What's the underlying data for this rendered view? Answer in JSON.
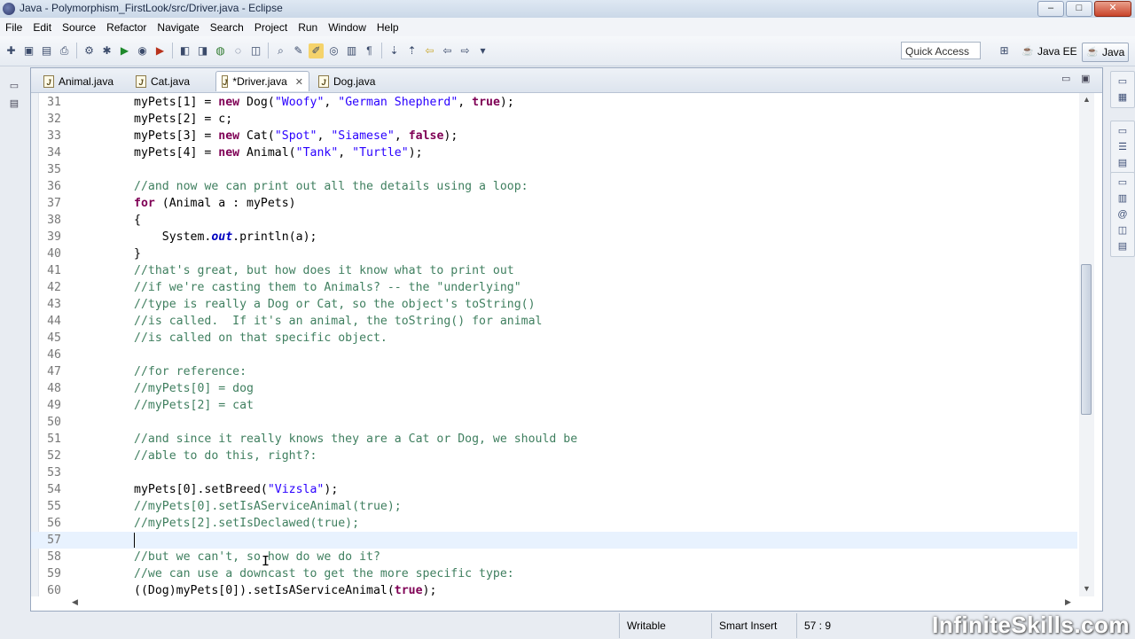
{
  "window": {
    "title": "Java - Polymorphism_FirstLook/src/Driver.java - Eclipse",
    "minimize": "–",
    "maximize": "□",
    "close": "✕"
  },
  "menu": [
    "File",
    "Edit",
    "Source",
    "Refactor",
    "Navigate",
    "Search",
    "Project",
    "Run",
    "Window",
    "Help"
  ],
  "toolbar": {
    "quick_access": "Quick Access",
    "perspectives": [
      {
        "label": "Java EE",
        "active": false
      },
      {
        "label": "Java",
        "active": true
      }
    ]
  },
  "tabs": [
    {
      "label": "Animal.java",
      "active": false
    },
    {
      "label": "Cat.java",
      "active": false
    },
    {
      "label": "*Driver.java",
      "active": true
    },
    {
      "label": "Dog.java",
      "active": false
    }
  ],
  "code_lines": [
    {
      "n": "31",
      "t": "myPets[1] = new Dog(\"Woofy\", \"German Shepherd\", true);"
    },
    {
      "n": "32",
      "t": "myPets[2] = c;"
    },
    {
      "n": "33",
      "t": "myPets[3] = new Cat(\"Spot\", \"Siamese\", false);"
    },
    {
      "n": "34",
      "t": "myPets[4] = new Animal(\"Tank\", \"Turtle\");"
    },
    {
      "n": "35",
      "t": ""
    },
    {
      "n": "36",
      "t": "//and now we can print out all the details using a loop:"
    },
    {
      "n": "37",
      "t": "for (Animal a : myPets)"
    },
    {
      "n": "38",
      "t": "{"
    },
    {
      "n": "39",
      "t": "    System.out.println(a);"
    },
    {
      "n": "40",
      "t": "}"
    },
    {
      "n": "41",
      "t": "//that's great, but how does it know what to print out"
    },
    {
      "n": "42",
      "t": "//if we're casting them to Animals? -- the \"underlying\""
    },
    {
      "n": "43",
      "t": "//type is really a Dog or Cat, so the object's toString()"
    },
    {
      "n": "44",
      "t": "//is called.  If it's an animal, the toString() for animal"
    },
    {
      "n": "45",
      "t": "//is called on that specific object."
    },
    {
      "n": "46",
      "t": ""
    },
    {
      "n": "47",
      "t": "//for reference:"
    },
    {
      "n": "48",
      "t": "//myPets[0] = dog"
    },
    {
      "n": "49",
      "t": "//myPets[2] = cat"
    },
    {
      "n": "50",
      "t": ""
    },
    {
      "n": "51",
      "t": "//and since it really knows they are a Cat or Dog, we should be"
    },
    {
      "n": "52",
      "t": "//able to do this, right?:"
    },
    {
      "n": "53",
      "t": ""
    },
    {
      "n": "54",
      "t": "myPets[0].setBreed(\"Vizsla\");"
    },
    {
      "n": "55",
      "t": "//myPets[0].setIsAServiceAnimal(true);"
    },
    {
      "n": "56",
      "t": "//myPets[2].setIsDeclawed(true);"
    },
    {
      "n": "57",
      "t": ""
    },
    {
      "n": "58",
      "t": "//but we can't, so how do we do it?"
    },
    {
      "n": "59",
      "t": "//we can use a downcast to get the more specific type:"
    },
    {
      "n": "60",
      "t": "((Dog)myPets[0]).setIsAServiceAnimal(true);"
    }
  ],
  "current_line": "57",
  "status": {
    "writable": "Writable",
    "insert_mode": "Smart Insert",
    "position": "57 : 9"
  },
  "watermark": "InfiniteSkills.com"
}
